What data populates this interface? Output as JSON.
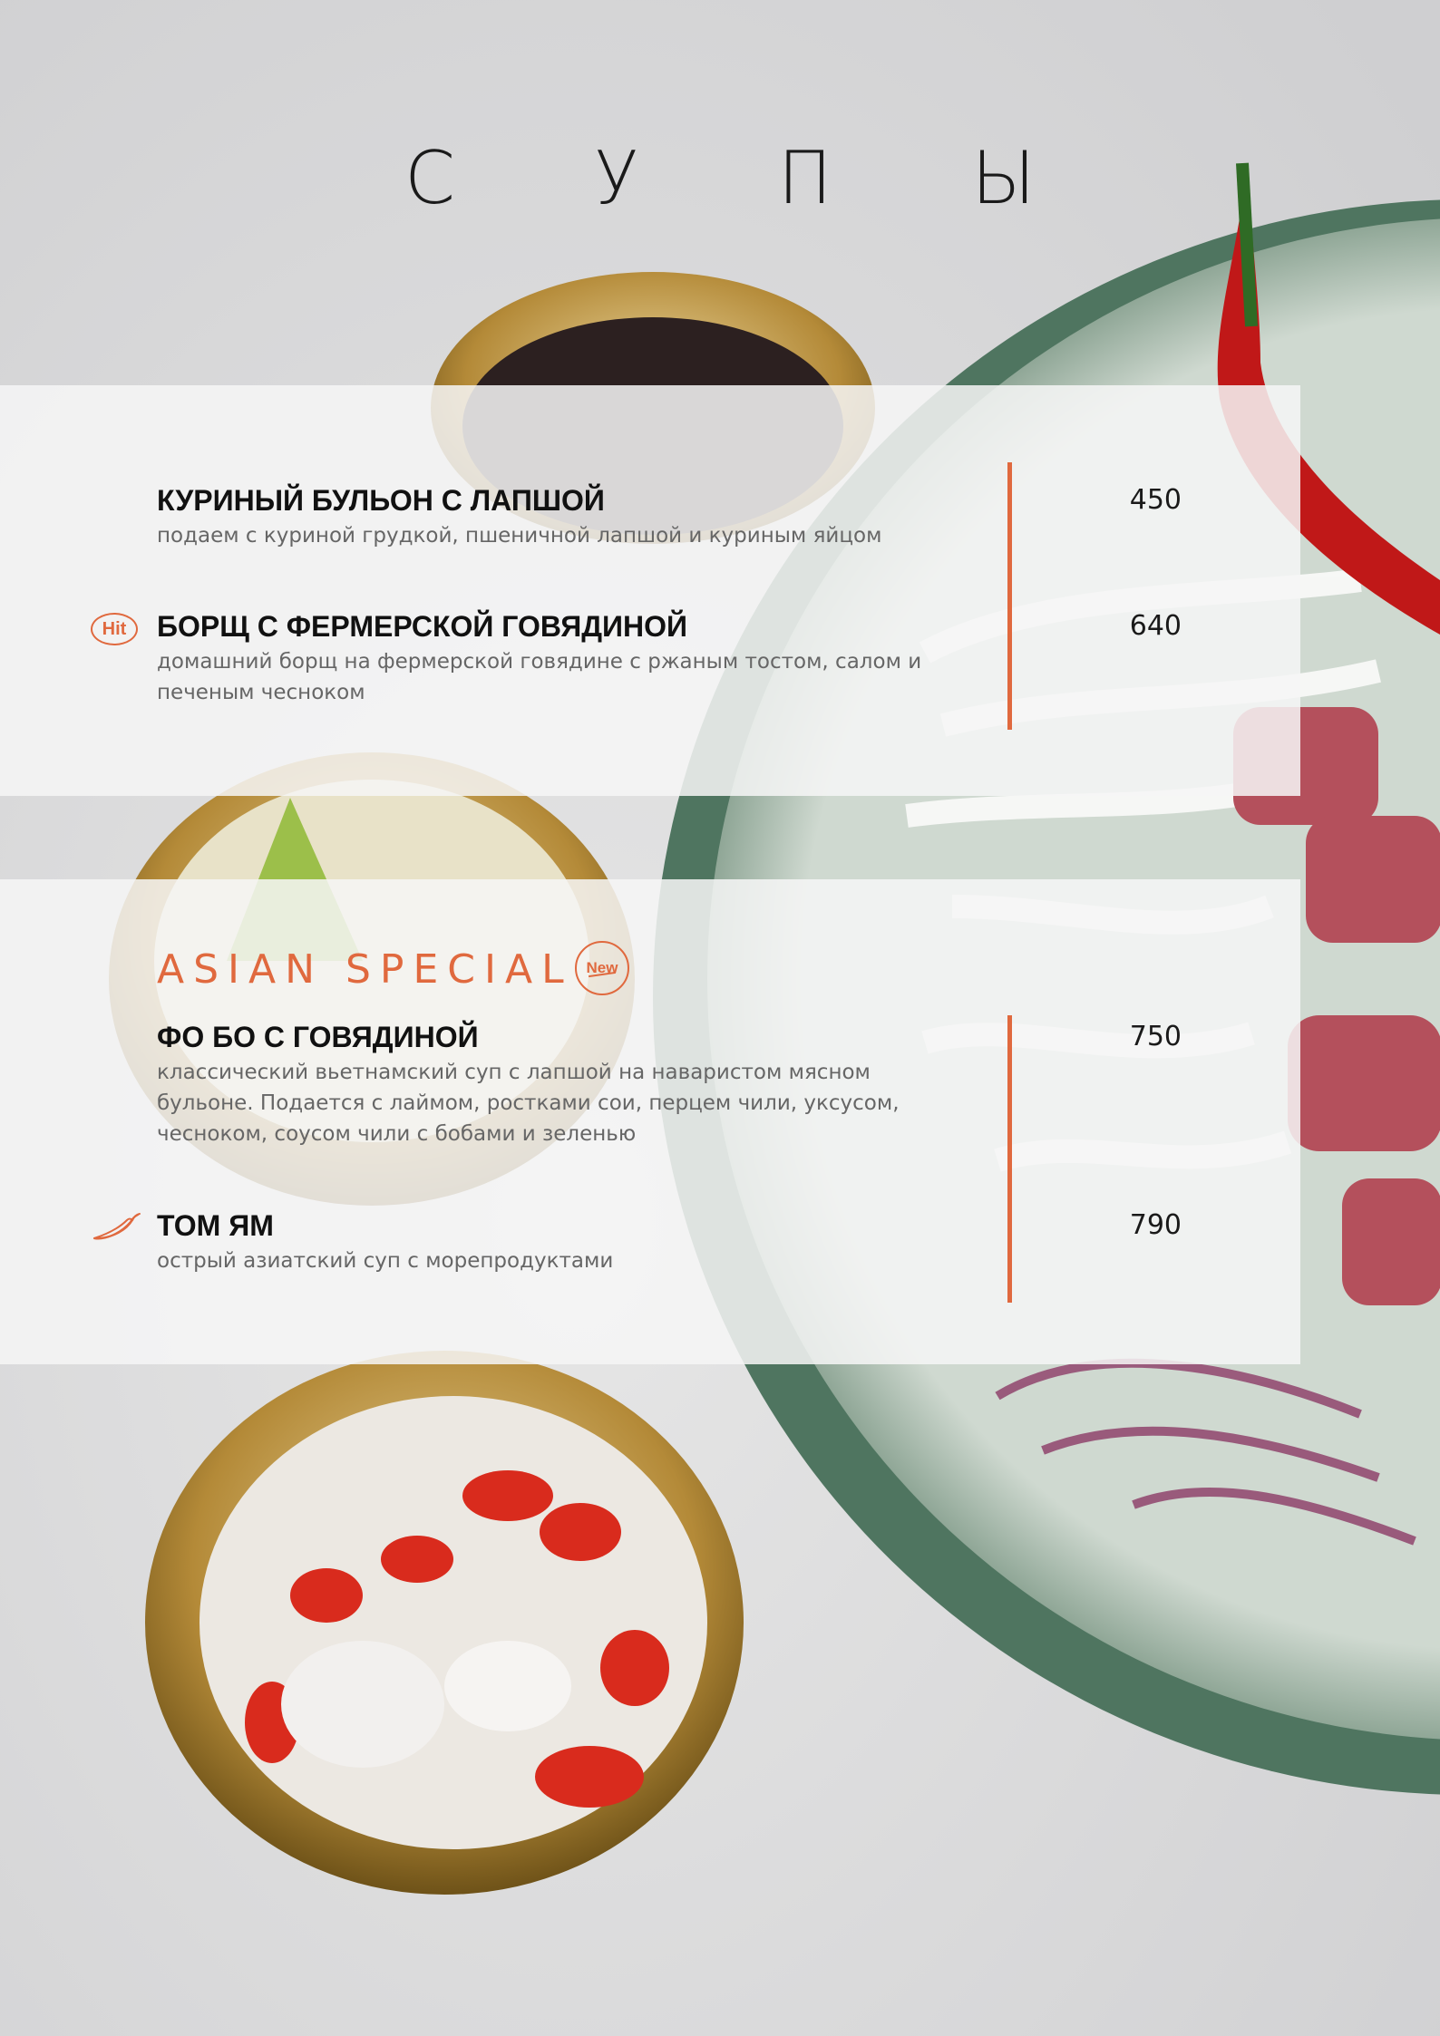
{
  "page": {
    "title": "С У П Ы"
  },
  "sections": [
    {
      "items": [
        {
          "name": "КУРИНЫЙ БУЛЬОН С ЛАПШОЙ",
          "description": "подаем с куриной грудкой, пшеничной лапшой и куриным яйцом",
          "price": "450"
        },
        {
          "badge": "Hit",
          "name": "БОРЩ С ФЕРМЕРСКОЙ ГОВЯДИНОЙ",
          "description": "домашний борщ на фермерской говядине с ржаным тостом, салом и печеным чесноком",
          "price": "640"
        }
      ]
    },
    {
      "title": "ASIAN SPECIAL",
      "badge": "New",
      "items": [
        {
          "name": "ФО БО С ГОВЯДИНОЙ",
          "description": "классический вьетнамский суп с лапшой на наваристом мясном бульоне. Подается с лаймом, ростками сои, перцем чили, уксусом, чесноком, соусом чили с бобами и зеленью",
          "price": "750"
        },
        {
          "icon": "chili-pepper-icon",
          "name": "ТОМ ЯМ",
          "description": "острый азиатский суп с морепродуктами",
          "price": "790"
        }
      ]
    }
  ],
  "colors": {
    "accent": "#e0693e",
    "text": "#111111",
    "muted": "#666666",
    "panel": "#f6f6f6"
  }
}
